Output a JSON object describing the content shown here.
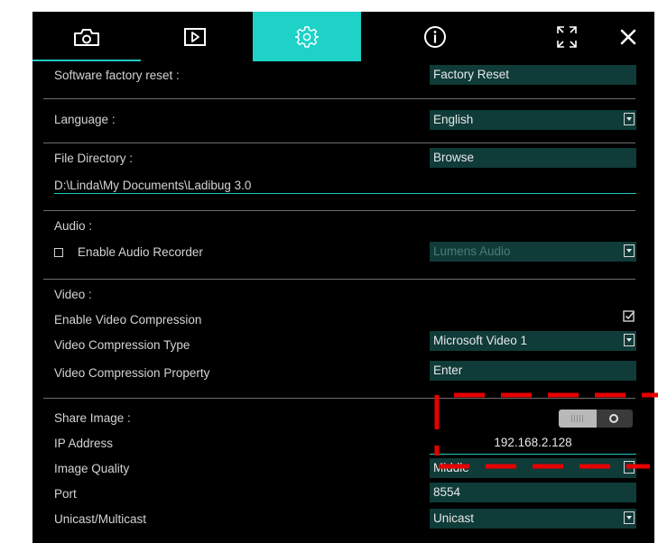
{
  "settings": {
    "factory_reset": {
      "label": "Software factory reset :",
      "button": "Factory Reset"
    },
    "language": {
      "label": "Language :",
      "value": "English"
    },
    "file_directory": {
      "label": "File Directory :",
      "button": "Browse",
      "path": "D:\\Linda\\My Documents\\Ladibug 3.0"
    },
    "audio": {
      "section_label": "Audio :",
      "enable_label": "Enable Audio Recorder",
      "enabled": false,
      "device": "Lumens Audio"
    },
    "video": {
      "section_label": "Video :",
      "compression_label": "Enable Video Compression",
      "compression_enabled": true,
      "type_label": "Video Compression Type",
      "type_value": "Microsoft Video 1",
      "property_label": "Video Compression Property",
      "property_button": "Enter"
    },
    "share": {
      "section_label": "Share Image :",
      "toggle_on": false,
      "ip_label": "IP Address",
      "ip_value": "192.168.2.128",
      "quality_label": "Image Quality",
      "quality_value": "Middle",
      "port_label": "Port",
      "port_value": "8554",
      "cast_label": "Unicast/Multicast",
      "cast_value": "Unicast"
    }
  },
  "colors": {
    "accent": "#1ed2c8",
    "field_bg": "#0f3b38",
    "annotation": "#e60000"
  },
  "toolbar_icons": [
    "camera-icon",
    "play-icon",
    "gear-icon",
    "info-icon",
    "fullscreen-icon",
    "close-icon"
  ]
}
